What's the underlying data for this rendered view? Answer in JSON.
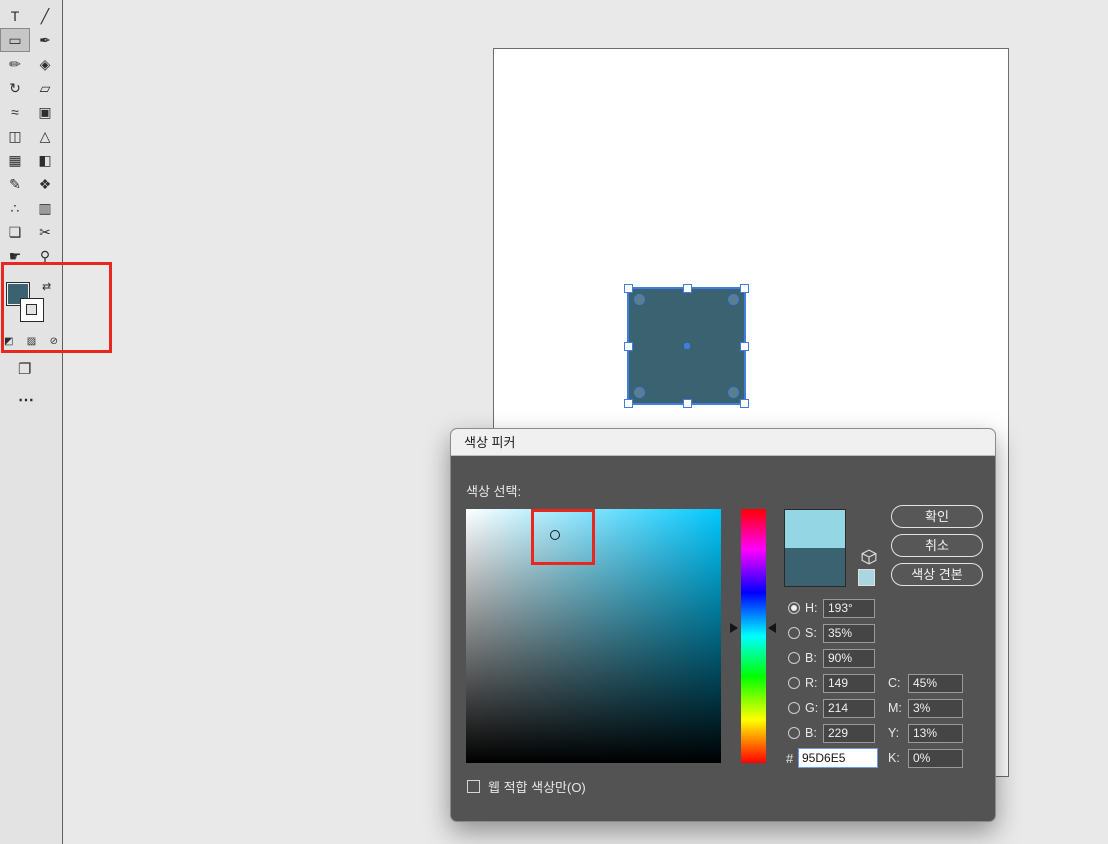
{
  "colors": {
    "fill-teal": "#3A6270",
    "new-color": "#95D6E5",
    "current-color": "#3A6270",
    "hue-base": "#00C8FF",
    "selection-blue": "#3F7DE0",
    "highlight-red": "#E8281E",
    "web-swatch": "#A9D6DF"
  },
  "toolbar": {
    "tools": [
      {
        "name": "type-tool",
        "glyph": "T"
      },
      {
        "name": "line-segment-tool",
        "glyph": "╱"
      },
      {
        "name": "rectangle-tool",
        "glyph": "▭"
      },
      {
        "name": "paintbrush-tool",
        "glyph": "✒"
      },
      {
        "name": "pencil-tool",
        "glyph": "✏"
      },
      {
        "name": "eraser-tool",
        "glyph": "◈"
      },
      {
        "name": "rotate-tool",
        "glyph": "↻"
      },
      {
        "name": "scale-tool",
        "glyph": "▱"
      },
      {
        "name": "width-tool",
        "glyph": "≈"
      },
      {
        "name": "free-transform-tool",
        "glyph": "▣"
      },
      {
        "name": "shape-builder-tool",
        "glyph": "◫"
      },
      {
        "name": "perspective-grid-tool",
        "glyph": "△"
      },
      {
        "name": "mesh-tool",
        "glyph": "▦"
      },
      {
        "name": "gradient-tool",
        "glyph": "◧"
      },
      {
        "name": "eyedropper-tool",
        "glyph": "✎"
      },
      {
        "name": "blend-tool",
        "glyph": "❖"
      },
      {
        "name": "symbol-sprayer-tool",
        "glyph": "∴"
      },
      {
        "name": "graph-tool",
        "glyph": "▥"
      },
      {
        "name": "artboard-tool",
        "glyph": "❏"
      },
      {
        "name": "slice-tool",
        "glyph": "✂"
      },
      {
        "name": "hand-tool",
        "glyph": "☛"
      },
      {
        "name": "zoom-tool",
        "glyph": "⚲"
      }
    ],
    "swap_glyph": "⇄",
    "mini1": "◩",
    "mini2": "▨",
    "mini3": "⊘",
    "screen_mode_glyph": "❐",
    "more_glyph": "⋯"
  },
  "dialog": {
    "title": "색상 피커",
    "select_label": "색상 선택:",
    "ok": "확인",
    "cancel": "취소",
    "swatches": "색상 견본",
    "web_only": "웹 적합 색상만(O)",
    "hex_label": "#",
    "hex_value": "95D6E5",
    "hsb": [
      {
        "label": "H:",
        "value": "193°"
      },
      {
        "label": "S:",
        "value": "35%"
      },
      {
        "label": "B:",
        "value": "90%"
      }
    ],
    "rgb": [
      {
        "label": "R:",
        "value": "149"
      },
      {
        "label": "G:",
        "value": "214"
      },
      {
        "label": "B:",
        "value": "229"
      }
    ],
    "cmyk": [
      {
        "label": "C:",
        "value": "45%"
      },
      {
        "label": "M:",
        "value": "3%"
      },
      {
        "label": "Y:",
        "value": "13%"
      },
      {
        "label": "K:",
        "value": "0%"
      }
    ]
  }
}
